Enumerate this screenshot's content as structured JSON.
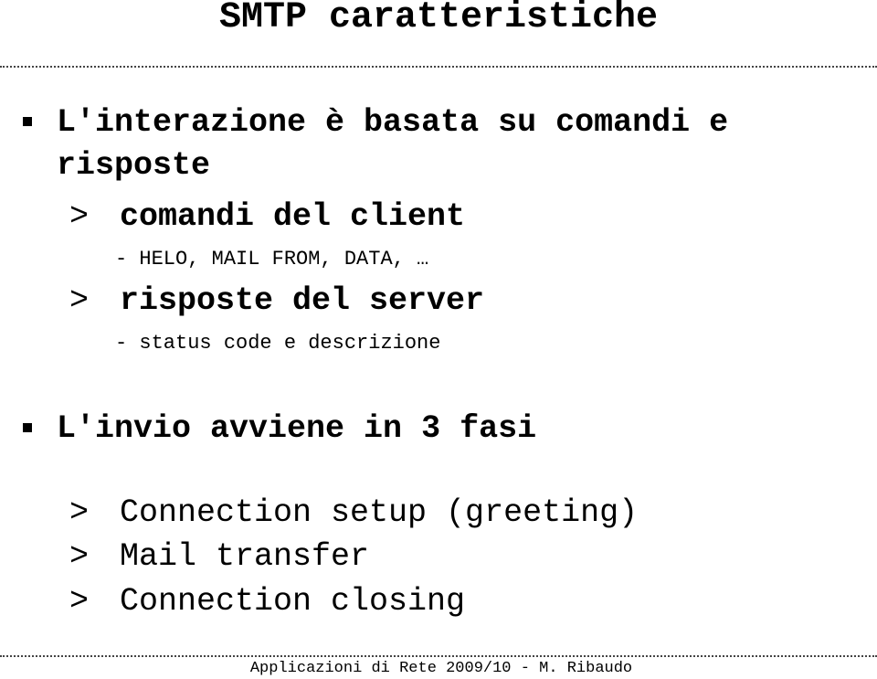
{
  "slide": {
    "title": "SMTP caratteristiche",
    "bullets": [
      {
        "text_line1": "L'interazione è basata su comandi e",
        "text_line2": "risposte",
        "sub": [
          {
            "marker": ">",
            "text": "comandi del client",
            "detail": "- HELO, MAIL FROM, DATA, …"
          },
          {
            "marker": ">",
            "text": "risposte del server",
            "detail": "- status code e descrizione"
          }
        ]
      },
      {
        "text_line1": "L'invio avviene in 3 fasi",
        "sub": [
          {
            "marker": ">",
            "text": "Connection setup (greeting)"
          },
          {
            "marker": ">",
            "text": "Mail transfer"
          },
          {
            "marker": ">",
            "text": "Connection closing"
          }
        ]
      }
    ],
    "footer": "Applicazioni di Rete 2009/10 - M. Ribaudo"
  }
}
